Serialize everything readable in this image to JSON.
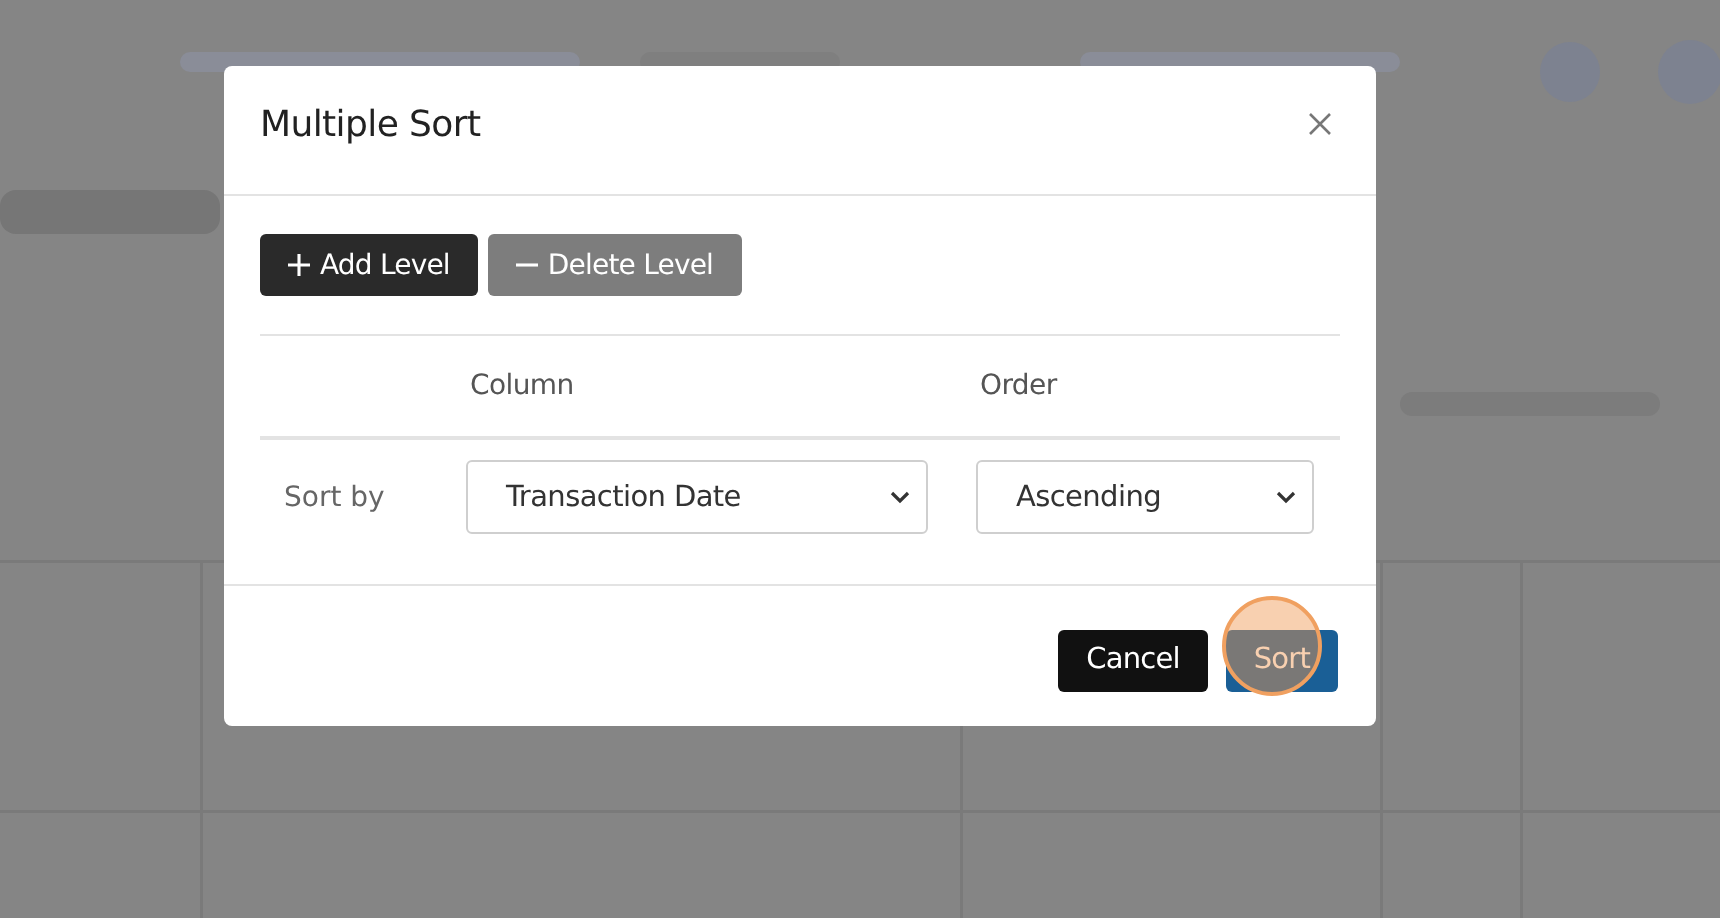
{
  "dialog": {
    "title": "Multiple Sort",
    "toolbar": [
      {
        "label": "Add Level",
        "kind": "add"
      },
      {
        "label": "Delete Level",
        "kind": "delete"
      }
    ],
    "columns": [
      "Column",
      "Order"
    ],
    "rows": [
      {
        "label": "Sort by",
        "column": "Transaction Date",
        "order": "Ascending"
      }
    ],
    "footer_buttons": [
      {
        "label": "Cancel",
        "kind": "secondary"
      },
      {
        "label": "Sort",
        "kind": "primary",
        "clicked": true
      }
    ]
  }
}
